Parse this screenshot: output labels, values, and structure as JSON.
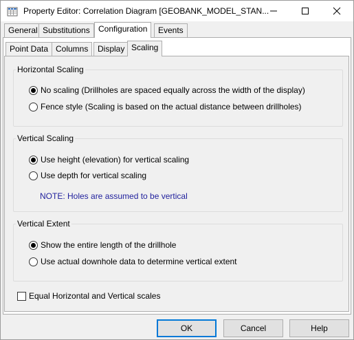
{
  "window": {
    "title": "Property Editor: Correlation Diagram [GEOBANK_MODEL_STAN...",
    "icon": "property-grid-icon"
  },
  "main_tabs": [
    {
      "label": "General"
    },
    {
      "label": "Substitutions"
    },
    {
      "label": "Configuration",
      "active": true
    },
    {
      "label": "Events"
    }
  ],
  "sub_tabs": [
    {
      "label": "Point Data"
    },
    {
      "label": "Columns"
    },
    {
      "label": "Display"
    },
    {
      "label": "Scaling",
      "active": true
    }
  ],
  "horizontal_scaling": {
    "title": "Horizontal Scaling",
    "options": [
      {
        "label": "No scaling  (Drillholes are spaced equally across the width of the display)",
        "selected": true
      },
      {
        "label": "Fence style  (Scaling is based on the actual distance between drillholes)",
        "selected": false
      }
    ]
  },
  "vertical_scaling": {
    "title": "Vertical Scaling",
    "options": [
      {
        "label": "Use height (elevation) for vertical scaling",
        "selected": true
      },
      {
        "label": "Use depth for vertical scaling",
        "selected": false
      }
    ],
    "note": "NOTE: Holes are assumed to be vertical"
  },
  "vertical_extent": {
    "title": "Vertical Extent",
    "options": [
      {
        "label": "Show the entire length of the drillhole",
        "selected": true
      },
      {
        "label": "Use actual downhole data to determine vertical extent",
        "selected": false
      }
    ]
  },
  "equal_scales": {
    "label": "Equal Horizontal and Vertical scales",
    "checked": false
  },
  "buttons": {
    "ok": "OK",
    "cancel": "Cancel",
    "help": "Help"
  },
  "colors": {
    "note_text": "#1f1f9c",
    "default_button_border": "#0078d7"
  }
}
